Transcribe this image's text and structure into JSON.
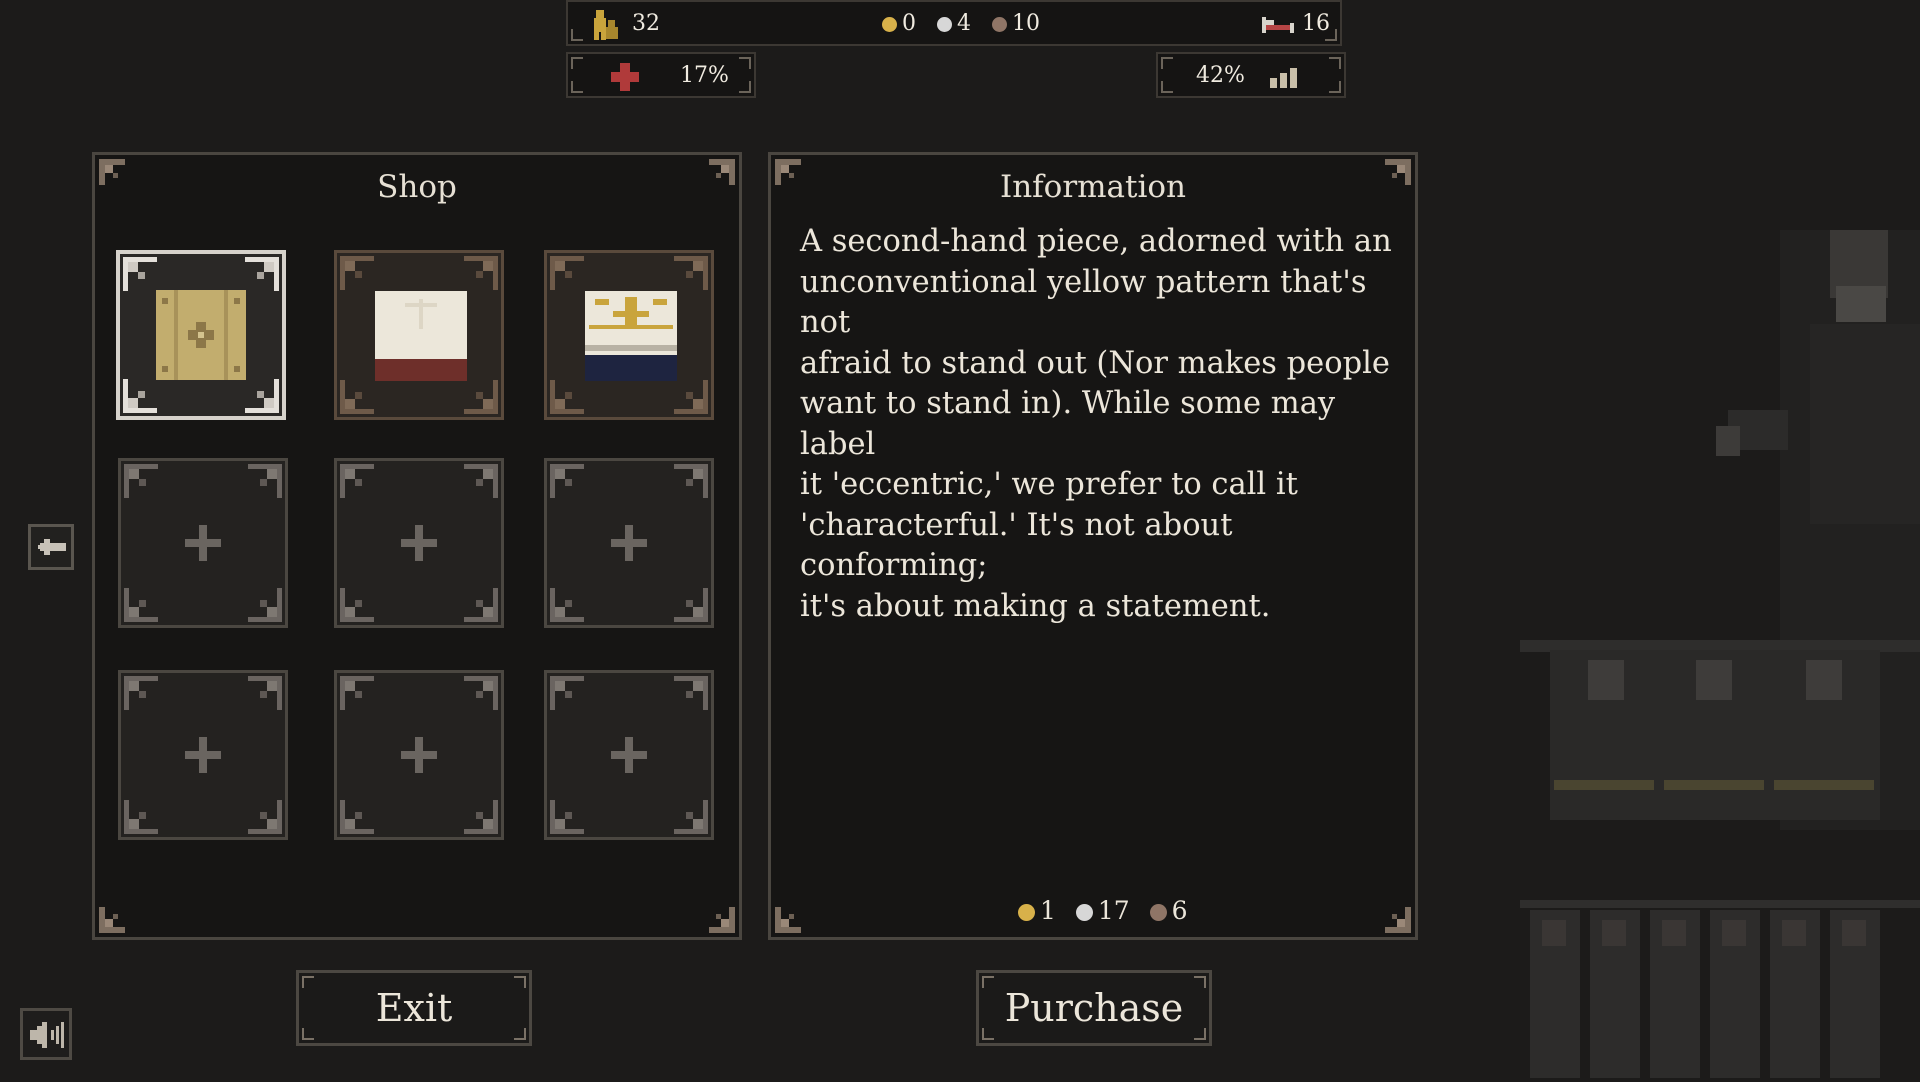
{
  "hud": {
    "population": "32",
    "coins": {
      "gold": "0",
      "silver": "4",
      "bronze": "10"
    },
    "beds": "16",
    "health": "17%",
    "signal": "42%"
  },
  "shop": {
    "title": "Shop",
    "items": [
      {
        "state": "selected",
        "pattern": "yellow"
      },
      {
        "state": "filled",
        "pattern": "white-red"
      },
      {
        "state": "filled",
        "pattern": "white-yellow-blue"
      },
      {
        "state": "empty"
      },
      {
        "state": "empty"
      },
      {
        "state": "empty"
      },
      {
        "state": "empty"
      },
      {
        "state": "empty"
      },
      {
        "state": "empty"
      }
    ]
  },
  "info": {
    "title": "Information",
    "lines": [
      "A second-hand piece, adorned with an",
      "unconventional yellow pattern that's not",
      "afraid to stand out (Nor makes people",
      "want to stand in). While some may label",
      "it 'eccentric,' we prefer to call it",
      "'characterful.' It's not about conforming;",
      "it's about making a statement."
    ],
    "price": {
      "gold": "1",
      "silver": "17",
      "bronze": "6"
    }
  },
  "buttons": {
    "exit": "Exit",
    "purchase": "Purchase"
  },
  "icons": {
    "back": "arrow-left-icon",
    "sound": "speaker-icon",
    "population": "people-icon",
    "beds": "bed-icon",
    "health": "red-cross-icon",
    "signal": "signal-bars-icon"
  },
  "colors": {
    "gold": "#d8b14a",
    "silver": "#d7d7d7",
    "bronze": "#8f7566",
    "cross": "#b03a3a",
    "bg": "#1c1b1a"
  }
}
